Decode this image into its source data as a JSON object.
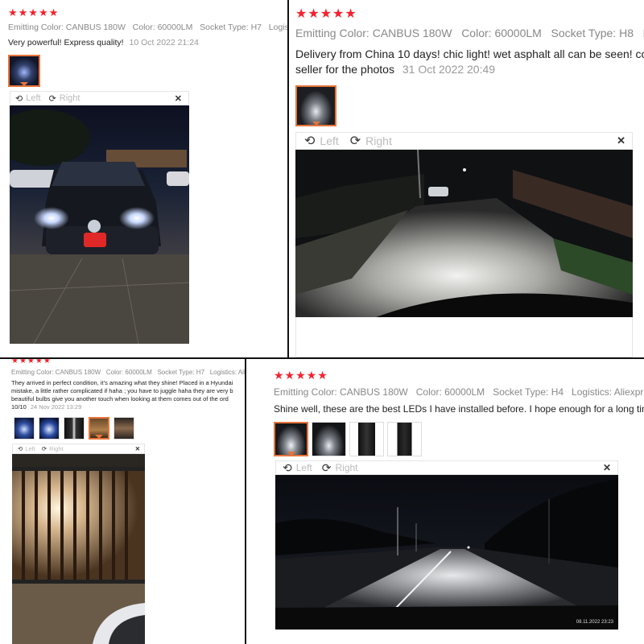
{
  "reviews": [
    {
      "stars": "★★★★★",
      "attrs": [
        {
          "key": "Emitting Color:",
          "val": "CANBUS 180W"
        },
        {
          "key": "Color:",
          "val": "60000LM"
        },
        {
          "key": "Socket Type:",
          "val": "H7"
        },
        {
          "key": "Logis",
          "val": ""
        }
      ],
      "text": "Very powerful! Express quality!",
      "date": "10 Oct 2022 21:24",
      "viewer": {
        "left": "Left",
        "right": "Right",
        "close": "✕"
      }
    },
    {
      "stars": "★★★★★",
      "attrs": [
        {
          "key": "Emitting Color:",
          "val": "CANBUS 180W"
        },
        {
          "key": "Color:",
          "val": "60000LM"
        },
        {
          "key": "Socket Type:",
          "val": "H8"
        },
        {
          "key": "L",
          "val": ""
        }
      ],
      "text_line1": "Delivery from China 10 days! chic light! wet asphalt all can be seen! co",
      "text_line2": "seller for the photos",
      "date": "31 Oct 2022 20:49",
      "viewer": {
        "left": "Left",
        "right": "Right",
        "close": "✕"
      }
    },
    {
      "stars": "★★★★★",
      "attrs": [
        {
          "key": "Emitting Color:",
          "val": "CANBUS 180W"
        },
        {
          "key": "Color:",
          "val": "60000LM"
        },
        {
          "key": "Socket Type:",
          "val": "H7"
        },
        {
          "key": "Logistics:",
          "val": "Aliex"
        }
      ],
      "text_lines": [
        "They arrived in perfect condition, it's amazing what they shine! Placed in a Hyundai",
        "mistake, a little rather complicated if haha ; you have to juggle haha they are very b",
        "beautiful bulbs give you another touch when looking at them comes out of the ord",
        "10/10"
      ],
      "date": "24 Nov 2022 13:29",
      "viewer": {
        "left": "Left",
        "right": "Right",
        "close": "✕"
      }
    },
    {
      "stars": "★★★★★",
      "attrs": [
        {
          "key": "Emitting Color:",
          "val": "CANBUS 180W"
        },
        {
          "key": "Color:",
          "val": "60000LM"
        },
        {
          "key": "Socket Type:",
          "val": "H4"
        },
        {
          "key": "Logistics:",
          "val": "Aliexpress S"
        }
      ],
      "text": "Shine well, these are the best LEDs I have installed before. I hope enough for a long time.",
      "viewer": {
        "left": "Left",
        "right": "Right",
        "close": "✕"
      },
      "photo_stamp": "08.11.2022  23:23"
    }
  ],
  "colors": {
    "stars": "#f5222d",
    "selected_thumb": "#e8743b",
    "divider": "#111111"
  }
}
